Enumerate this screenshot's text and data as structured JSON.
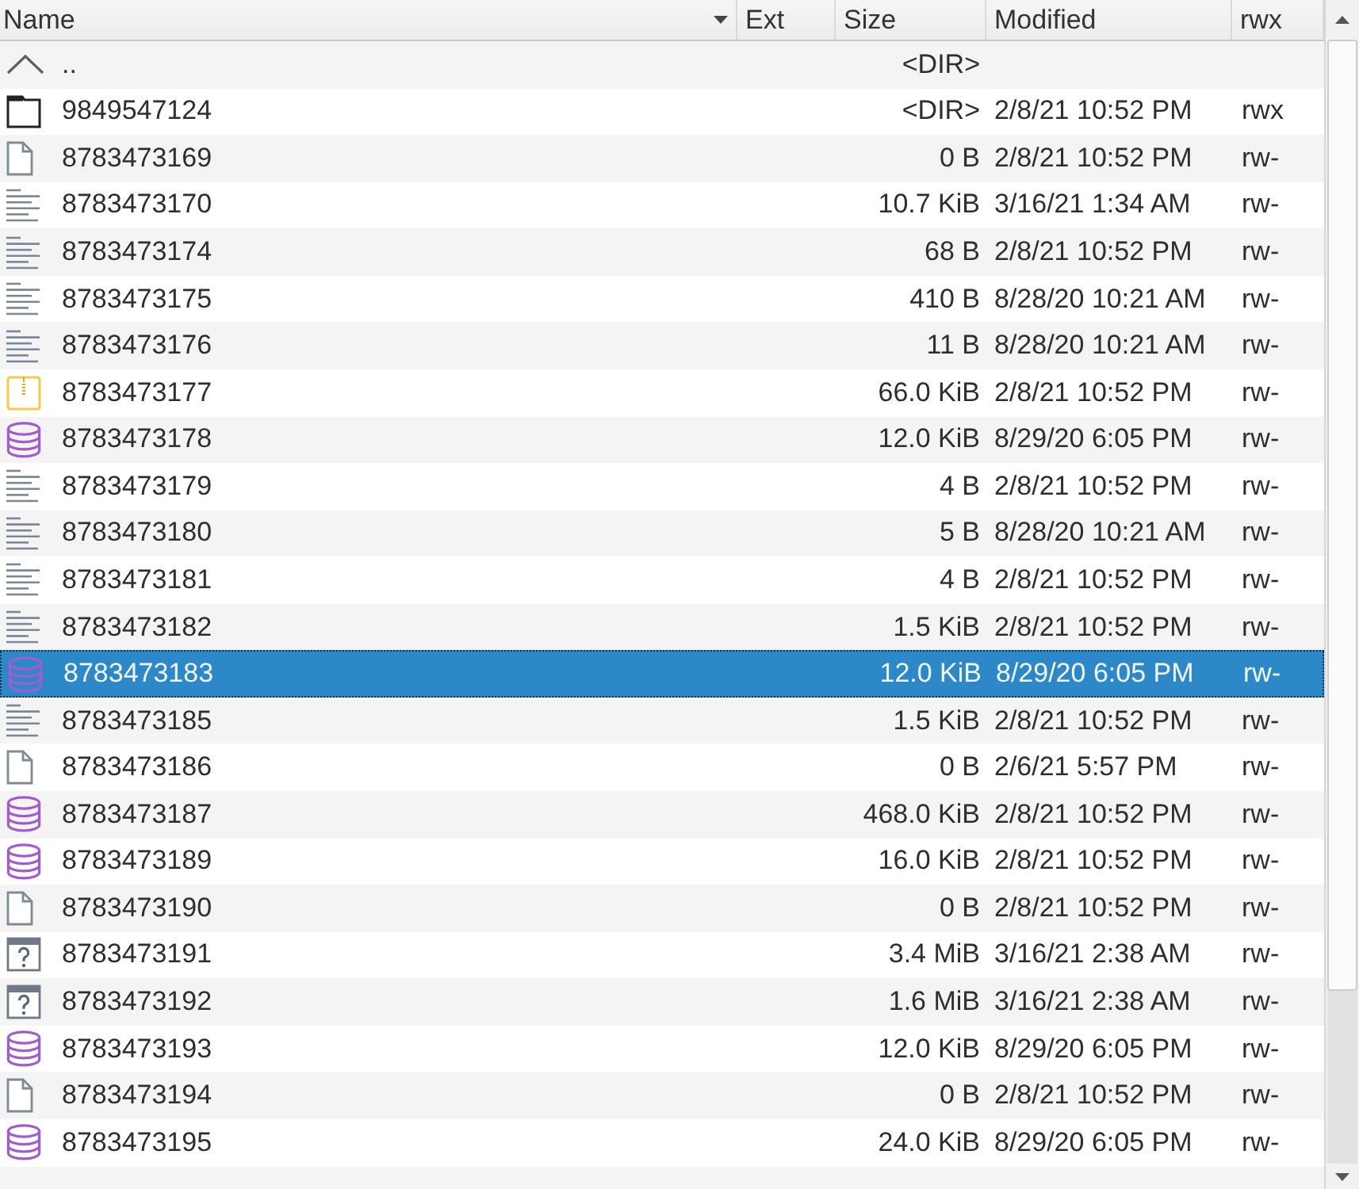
{
  "columns": [
    {
      "label": "Name",
      "sorted": true
    },
    {
      "label": "Ext",
      "sorted": false
    },
    {
      "label": "Size",
      "sorted": false
    },
    {
      "label": "Modified",
      "sorted": false
    },
    {
      "label": "rwx",
      "sorted": false
    }
  ],
  "rows": [
    {
      "kind": "up",
      "name": "..",
      "size": "<DIR>",
      "selected": false
    },
    {
      "kind": "folder",
      "name": "9849547124",
      "size": "<DIR>",
      "modified": "2/8/21 10:52 PM",
      "rwx": "rwx",
      "selected": false
    },
    {
      "kind": "file",
      "name": "8783473169",
      "size": "0 B",
      "modified": "2/8/21 10:52 PM",
      "rwx": "rw-",
      "selected": false
    },
    {
      "kind": "text",
      "name": "8783473170",
      "size": "10.7 KiB",
      "modified": "3/16/21 1:34 AM",
      "rwx": "rw-",
      "selected": false
    },
    {
      "kind": "text",
      "name": "8783473174",
      "size": "68 B",
      "modified": "2/8/21 10:52 PM",
      "rwx": "rw-",
      "selected": false
    },
    {
      "kind": "text",
      "name": "8783473175",
      "size": "410 B",
      "modified": "8/28/20 10:21 AM",
      "rwx": "rw-",
      "selected": false
    },
    {
      "kind": "text",
      "name": "8783473176",
      "size": "11 B",
      "modified": "8/28/20 10:21 AM",
      "rwx": "rw-",
      "selected": false
    },
    {
      "kind": "archive",
      "name": "8783473177",
      "size": "66.0 KiB",
      "modified": "2/8/21 10:52 PM",
      "rwx": "rw-",
      "selected": false
    },
    {
      "kind": "database",
      "name": "8783473178",
      "size": "12.0 KiB",
      "modified": "8/29/20 6:05 PM",
      "rwx": "rw-",
      "selected": false
    },
    {
      "kind": "text",
      "name": "8783473179",
      "size": "4 B",
      "modified": "2/8/21 10:52 PM",
      "rwx": "rw-",
      "selected": false
    },
    {
      "kind": "text",
      "name": "8783473180",
      "size": "5 B",
      "modified": "8/28/20 10:21 AM",
      "rwx": "rw-",
      "selected": false
    },
    {
      "kind": "text",
      "name": "8783473181",
      "size": "4 B",
      "modified": "2/8/21 10:52 PM",
      "rwx": "rw-",
      "selected": false
    },
    {
      "kind": "text",
      "name": "8783473182",
      "size": "1.5 KiB",
      "modified": "2/8/21 10:52 PM",
      "rwx": "rw-",
      "selected": false
    },
    {
      "kind": "database",
      "name": "8783473183",
      "size": "12.0 KiB",
      "modified": "8/29/20 6:05 PM",
      "rwx": "rw-",
      "selected": true
    },
    {
      "kind": "text",
      "name": "8783473185",
      "size": "1.5 KiB",
      "modified": "2/8/21 10:52 PM",
      "rwx": "rw-",
      "selected": false
    },
    {
      "kind": "file",
      "name": "8783473186",
      "size": "0 B",
      "modified": "2/6/21 5:57 PM",
      "rwx": "rw-",
      "selected": false
    },
    {
      "kind": "database",
      "name": "8783473187",
      "size": "468.0 KiB",
      "modified": "2/8/21 10:52 PM",
      "rwx": "rw-",
      "selected": false
    },
    {
      "kind": "database",
      "name": "8783473189",
      "size": "16.0 KiB",
      "modified": "2/8/21 10:52 PM",
      "rwx": "rw-",
      "selected": false
    },
    {
      "kind": "file",
      "name": "8783473190",
      "size": "0 B",
      "modified": "2/8/21 10:52 PM",
      "rwx": "rw-",
      "selected": false
    },
    {
      "kind": "binary",
      "name": "8783473191",
      "size": "3.4 MiB",
      "modified": "3/16/21 2:38 AM",
      "rwx": "rw-",
      "selected": false
    },
    {
      "kind": "binary",
      "name": "8783473192",
      "size": "1.6 MiB",
      "modified": "3/16/21 2:38 AM",
      "rwx": "rw-",
      "selected": false
    },
    {
      "kind": "database",
      "name": "8783473193",
      "size": "12.0 KiB",
      "modified": "8/29/20 6:05 PM",
      "rwx": "rw-",
      "selected": false
    },
    {
      "kind": "file",
      "name": "8783473194",
      "size": "0 B",
      "modified": "2/8/21 10:52 PM",
      "rwx": "rw-",
      "selected": false
    },
    {
      "kind": "database",
      "name": "8783473195",
      "size": "24.0 KiB",
      "modified": "8/29/20 6:05 PM",
      "rwx": "rw-",
      "selected": false
    }
  ]
}
